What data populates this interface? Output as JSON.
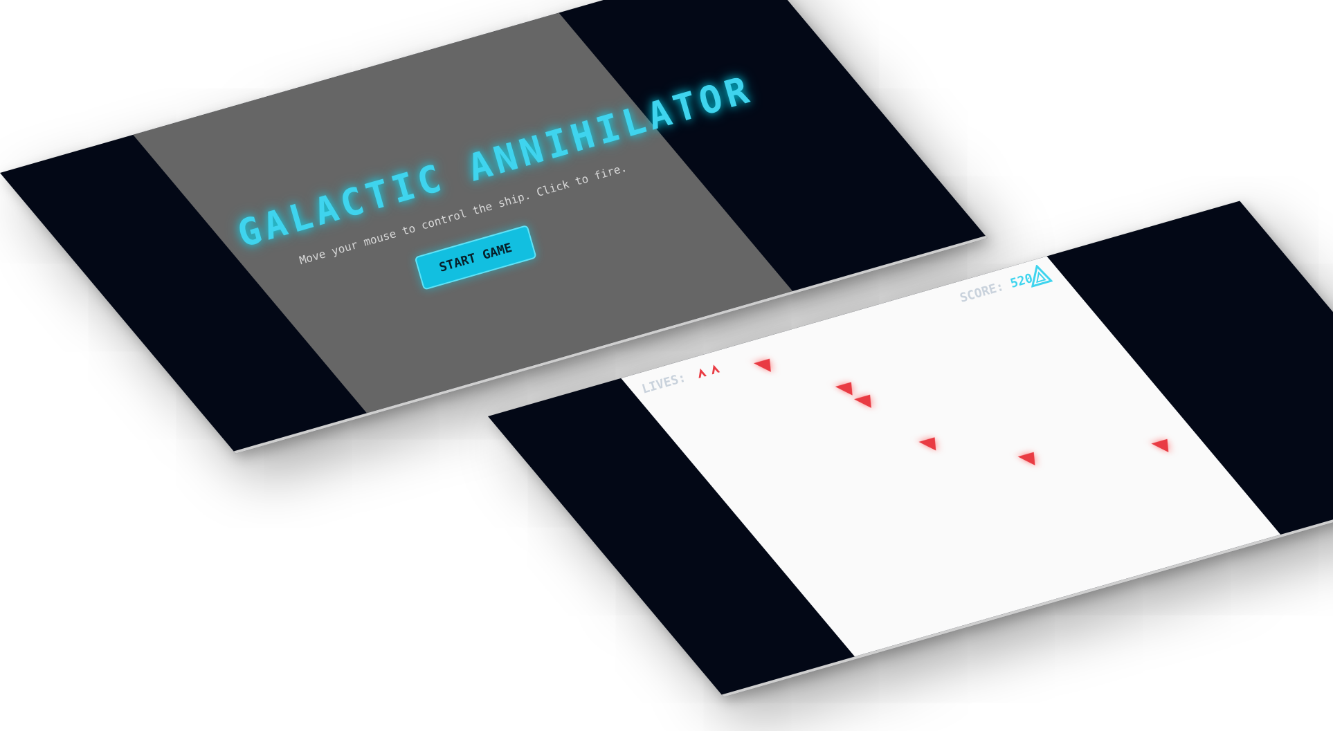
{
  "start_screen": {
    "title": "GALACTIC ANNIHILATOR",
    "instructions": "Move your mouse to control the ship. Click to fire.",
    "start_button_label": "START GAME"
  },
  "game_screen": {
    "lives_label": "LIVES:",
    "lives_remaining": 2,
    "score_label": "SCORE:",
    "score_value": "520",
    "enemy_count": 6
  },
  "colors": {
    "background_dark": "#030816",
    "overlay_gray": "#666666",
    "accent_cyan": "#3fd4ee",
    "button_cyan": "#12bfe0",
    "enemy_red": "#e93b43",
    "playfield": "#fafafa",
    "hud_text": "#c9d2dc"
  },
  "icons": {
    "life": "ship-icon",
    "enemy": "enemy-triangle-icon",
    "player": "player-ship-icon"
  }
}
